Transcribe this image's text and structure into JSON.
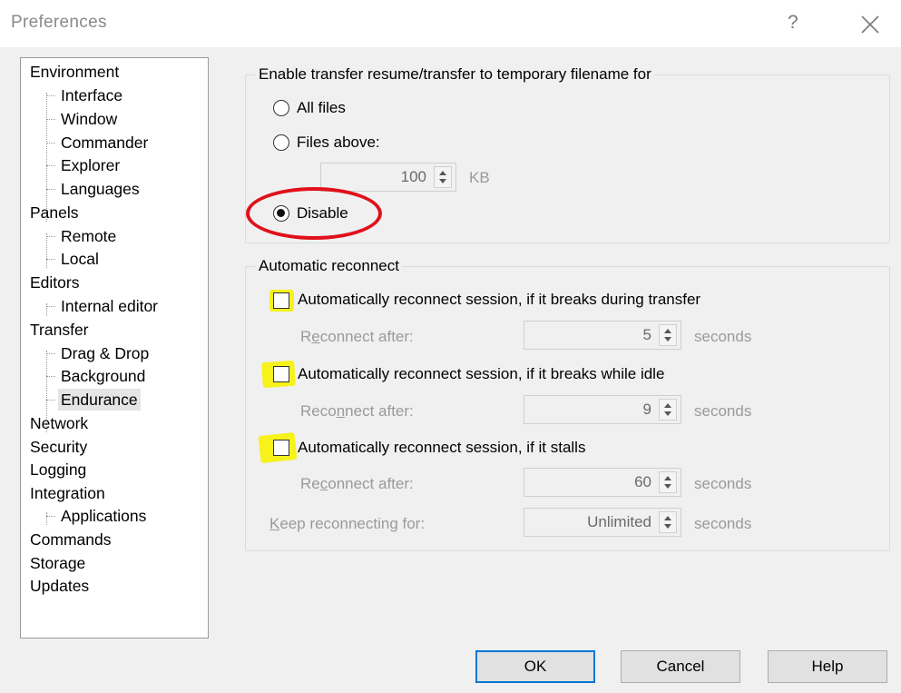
{
  "window": {
    "title": "Preferences",
    "help_glyph": "?",
    "close_icon": "close-icon"
  },
  "tree": {
    "items": [
      {
        "label": "Environment",
        "level": 0
      },
      {
        "label": "Interface",
        "level": 1
      },
      {
        "label": "Window",
        "level": 1
      },
      {
        "label": "Commander",
        "level": 1
      },
      {
        "label": "Explorer",
        "level": 1
      },
      {
        "label": "Languages",
        "level": 1
      },
      {
        "label": "Panels",
        "level": 0
      },
      {
        "label": "Remote",
        "level": 1
      },
      {
        "label": "Local",
        "level": 1
      },
      {
        "label": "Editors",
        "level": 0
      },
      {
        "label": "Internal editor",
        "level": 1
      },
      {
        "label": "Transfer",
        "level": 0
      },
      {
        "label": "Drag & Drop",
        "level": 1
      },
      {
        "label": "Background",
        "level": 1
      },
      {
        "label": "Endurance",
        "level": 1,
        "selected": true
      },
      {
        "label": "Network",
        "level": 0
      },
      {
        "label": "Security",
        "level": 0
      },
      {
        "label": "Logging",
        "level": 0
      },
      {
        "label": "Integration",
        "level": 0
      },
      {
        "label": "Applications",
        "level": 1
      },
      {
        "label": "Commands",
        "level": 0
      },
      {
        "label": "Storage",
        "level": 0
      },
      {
        "label": "Updates",
        "level": 0
      }
    ]
  },
  "resume_group": {
    "title": "Enable transfer resume/transfer to temporary filename for",
    "all_files": "All files",
    "files_above": "Files above:",
    "files_above_value": "100",
    "unit": "KB",
    "disable": "Disable",
    "selected": "disable"
  },
  "reconnect_group": {
    "title": "Automatic reconnect",
    "transfer": {
      "label": "Automatically reconnect session, if it breaks during transfer",
      "checked": false,
      "after_pre": "R",
      "after_u": "e",
      "after_post": "connect after:",
      "value": "5",
      "unit": "seconds"
    },
    "idle": {
      "label": "Automatically reconnect session, if it breaks while idle",
      "checked": false,
      "after_pre": "Reco",
      "after_u": "n",
      "after_post": "nect after:",
      "value": "9",
      "unit": "seconds"
    },
    "stalls": {
      "label": "Automatically reconnect session, if it stalls",
      "checked": false,
      "after_pre": "Re",
      "after_u": "c",
      "after_post": "onnect after:",
      "value": "60",
      "unit": "seconds"
    },
    "keep": {
      "label_u": "K",
      "label_post": "eep reconnecting for:",
      "value": "Unlimited",
      "unit": "seconds"
    }
  },
  "buttons": {
    "ok": "OK",
    "cancel": "Cancel",
    "help": "Help"
  },
  "annotation_colors": {
    "highlight": "#f6f21a",
    "circle": "#e0101a"
  }
}
